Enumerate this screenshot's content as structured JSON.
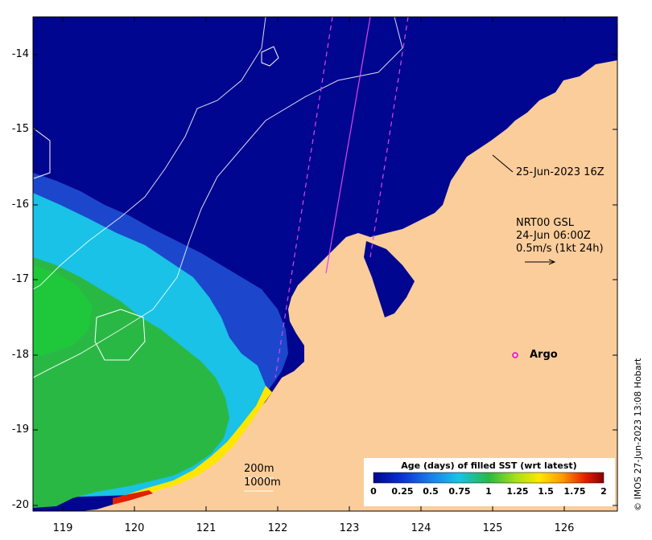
{
  "map": {
    "lat_ticks": [
      "-14",
      "-15",
      "-16",
      "-17",
      "-18",
      "-19",
      "-20"
    ],
    "lon_ticks": [
      "119",
      "120",
      "121",
      "122",
      "123",
      "124",
      "125",
      "126"
    ],
    "colors": {
      "land": "#fbcd9b",
      "deep_ocean": "#00068f",
      "mid_blue": "#1f4fd4",
      "cyan": "#19c2e6",
      "green": "#2ab845",
      "track": "#d946ef"
    }
  },
  "annotations": {
    "track_time": "25-Jun-2023 16Z",
    "vector_product": "NRT00 GSL",
    "vector_time": "24-Jun 06:00Z",
    "vector_scale": "0.5m/s (1kt 24h)",
    "argo_label": "Argo",
    "contour_200": "200m",
    "contour_1000": "1000m",
    "credit": "© IMOS 27-Jun-2023 13:08 Hobart"
  },
  "colorbar": {
    "title": "Age (days) of filled SST (wrt latest)",
    "ticks": [
      "0",
      "0.25",
      "0.5",
      "0.75",
      "1",
      "1.25",
      "1.5",
      "1.75",
      "2"
    ]
  }
}
